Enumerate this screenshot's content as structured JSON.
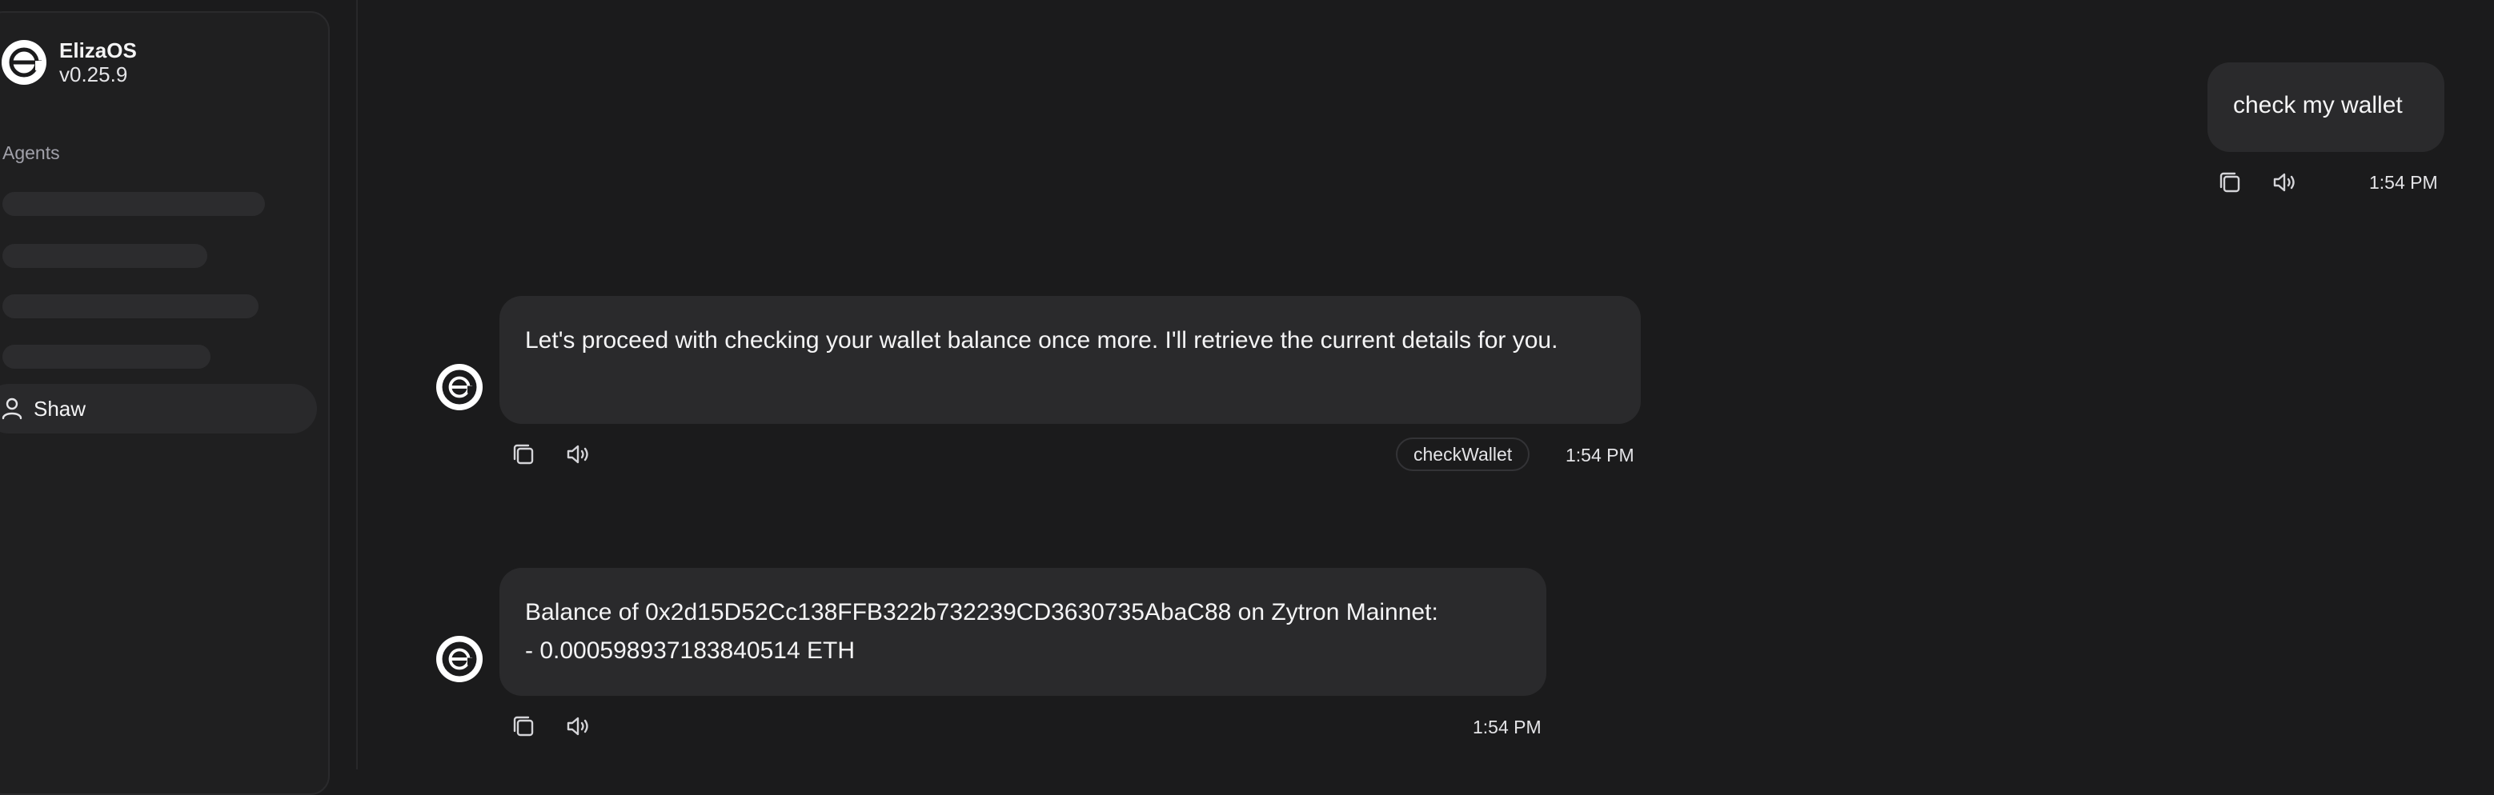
{
  "sidebar": {
    "brand_name": "ElizaOS",
    "version": "v0.25.9",
    "section_label": "Agents",
    "agent_name": "Shaw"
  },
  "messages": [
    {
      "role": "user",
      "text": "check my wallet",
      "time": "1:54 PM"
    },
    {
      "role": "agent",
      "text": "Let's proceed with checking your wallet balance once more. I'll retrieve the current details for you.",
      "action": "checkWallet",
      "time": "1:54 PM"
    },
    {
      "role": "agent",
      "line1": "Balance of 0x2d15D52Cc138FFB322b732239CD3630735AbaC88 on Zytron Mainnet:",
      "line2": "- 0.000598937183840514 ETH",
      "time": "1:54 PM"
    }
  ],
  "icons": {
    "logo": "elizaos-logo-icon",
    "user": "user-icon",
    "copy": "copy-icon",
    "speaker": "speaker-icon"
  },
  "colors": {
    "background": "#1b1b1c",
    "bubble": "#2a2a2c",
    "sidebar": "#1f1f20"
  }
}
